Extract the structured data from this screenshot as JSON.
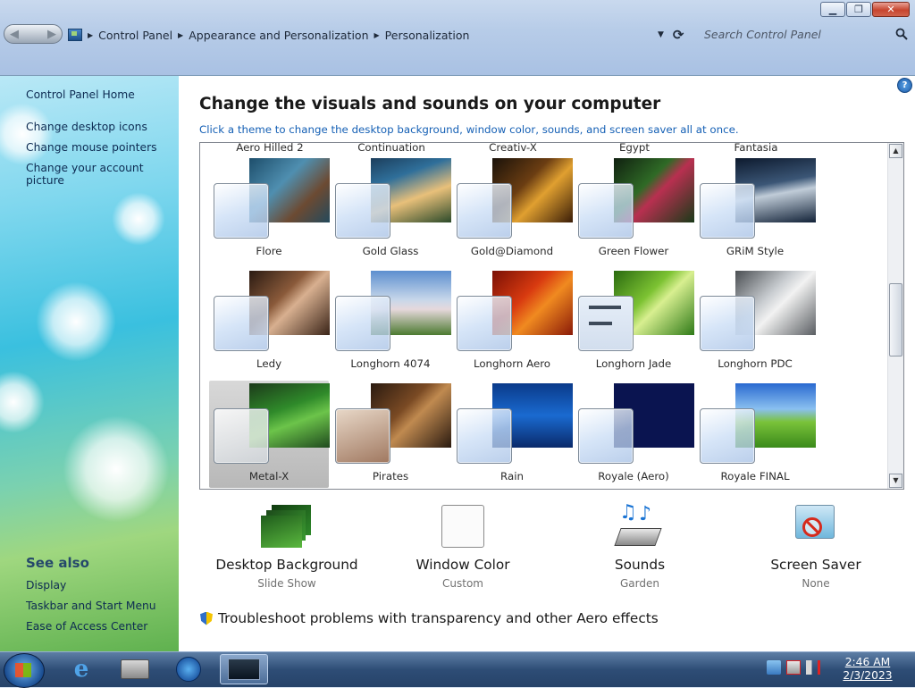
{
  "window": {
    "minimize_icon": "minimize-icon",
    "maximize_icon": "restore-icon",
    "close_icon": "close-icon"
  },
  "address_bar": {
    "breadcrumbs": [
      "Control Panel",
      "Appearance and Personalization",
      "Personalization"
    ],
    "search_placeholder": "Search Control Panel"
  },
  "left_pane": {
    "home": "Control Panel Home",
    "links": [
      "Change desktop icons",
      "Change mouse pointers",
      "Change your account picture"
    ],
    "see_also_heading": "See also",
    "see_also": [
      "Display",
      "Taskbar and Start Menu",
      "Ease of Access Center"
    ]
  },
  "main": {
    "title": "Change the visuals and sounds on your computer",
    "subtitle": "Click a theme to change the desktop background, window color, sounds, and screen saver all at once.",
    "top_row_names": [
      "Aero Hilled 2",
      "Continuation",
      "Creativ-X",
      "Egypt",
      "Fantasia"
    ],
    "themes_row1": [
      "Flore",
      "Gold Glass",
      "Gold@Diamond",
      "Green Flower",
      "GRiM Style"
    ],
    "themes_row2": [
      "Ledy",
      "Longhorn 4074",
      "Longhorn Aero",
      "Longhorn Jade",
      "Longhorn PDC"
    ],
    "themes_row3": [
      "Metal-X",
      "Pirates",
      "Rain",
      "Royale (Aero)",
      "Royale FINAL"
    ],
    "selected_theme": "Metal-X"
  },
  "controls": [
    {
      "label": "Desktop Background",
      "value": "Slide Show"
    },
    {
      "label": "Window Color",
      "value": "Custom"
    },
    {
      "label": "Sounds",
      "value": "Garden"
    },
    {
      "label": "Screen Saver",
      "value": "None"
    }
  ],
  "troubleshoot": "Troubleshoot problems with transparency and other Aero effects",
  "taskbar": {
    "time": "2:46 AM",
    "date": "2/3/2023"
  }
}
